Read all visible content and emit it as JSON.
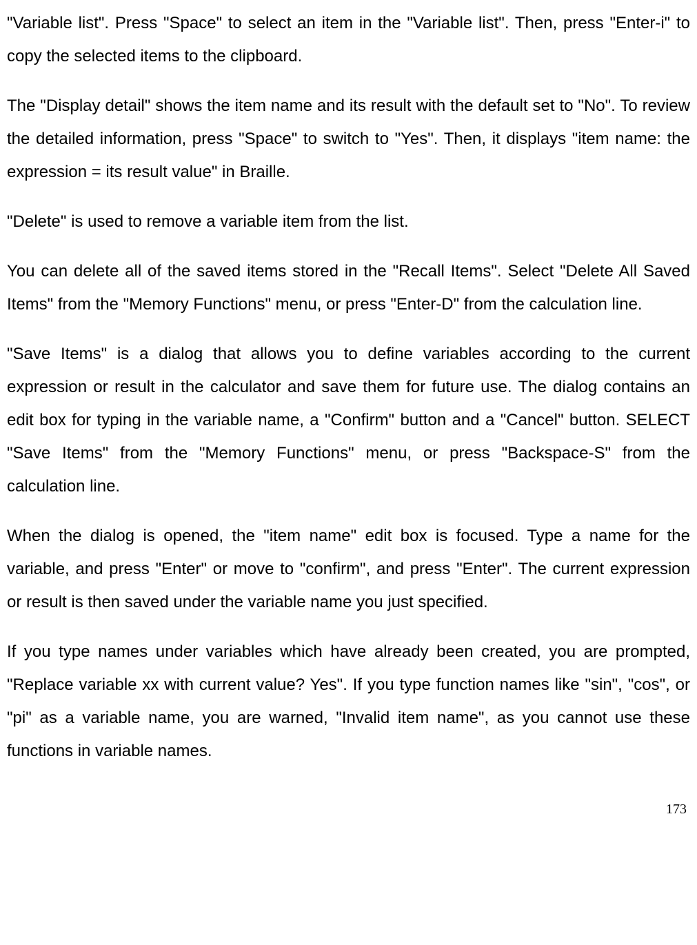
{
  "paragraphs": {
    "p1": "\"Variable list\". Press \"Space\" to select an item in the \"Variable list\". Then, press \"Enter-i\" to copy the selected items to the clipboard.",
    "p2": "The \"Display detail\" shows the item name and its result with the default set to \"No\". To review the detailed information, press \"Space\" to switch to \"Yes\". Then, it displays \"item name: the expression = its result value\" in Braille.",
    "p3": "\"Delete\" is used to remove a variable item from the list.",
    "p4": "You can delete all of the saved items stored in the \"Recall Items\". Select \"Delete All Saved Items\" from the \"Memory Functions\" menu, or press \"Enter-D\" from the calculation line.",
    "p5": "\"Save Items\" is a dialog that allows you to define variables according to the current expression or result in the calculator and save them for future use. The dialog contains an edit box for typing in the variable name, a \"Confirm\" button and a \"Cancel\" button. SELECT \"Save Items\" from the \"Memory Functions\" menu, or press \"Backspace-S\" from the calculation line.",
    "p6": "When the dialog is opened, the \"item name\" edit box is focused. Type a name for the variable, and press \"Enter\" or move to \"confirm\", and press \"Enter\". The current expression or result is then saved under the variable name you just specified.",
    "p7": "If you type names under variables which have already been created, you are prompted, \"Replace variable xx with current value? Yes\". If you type function names like \"sin\", \"cos\", or \"pi\" as a variable name, you are warned, \"Invalid item name\", as you cannot use these functions in variable names."
  },
  "pageNumber": "173"
}
